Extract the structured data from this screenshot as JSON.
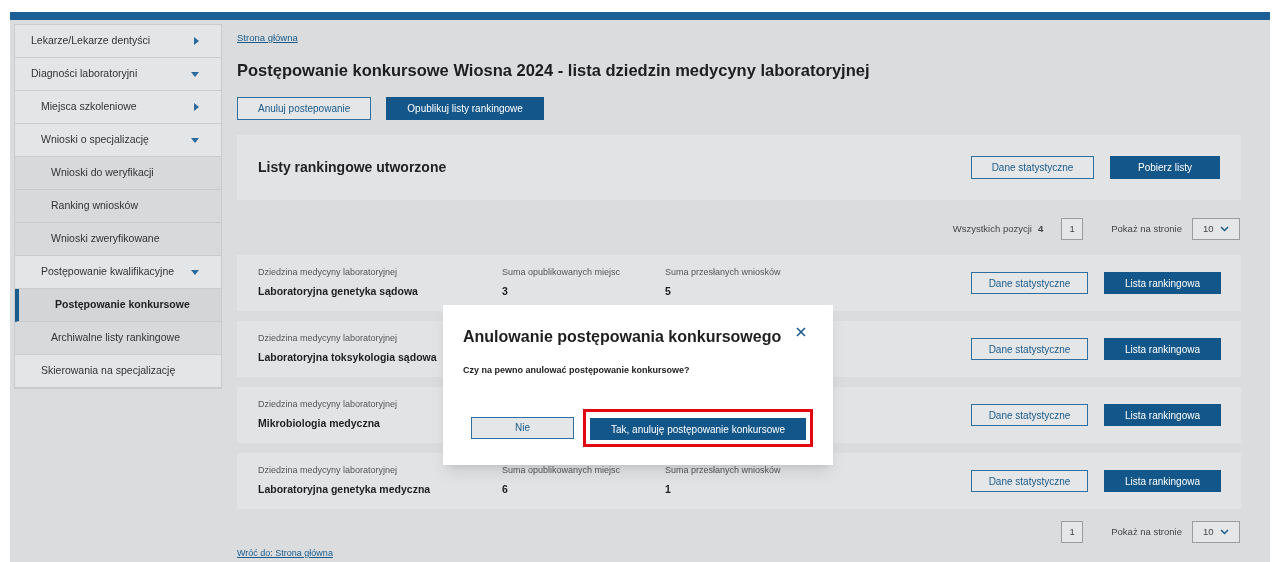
{
  "sidebar": {
    "items": [
      {
        "label": "Lekarze/Lekarze dentyści",
        "expanded": false,
        "selected": false
      },
      {
        "label": "Diagności laboratoryjni",
        "expanded": true,
        "selected": false,
        "children": [
          {
            "label": "Miejsca szkoleniowe",
            "expanded": false,
            "selected": false
          },
          {
            "label": "Wnioski o specjalizację",
            "expanded": true,
            "selected": false,
            "children": [
              {
                "label": "Wnioski do weryfikacji",
                "selected": false
              },
              {
                "label": "Ranking wniosków",
                "selected": false
              },
              {
                "label": "Wnioski zweryfikowane",
                "selected": false
              }
            ]
          },
          {
            "label": "Postępowanie kwalifikacyjne",
            "expanded": true,
            "selected": false,
            "children": [
              {
                "label": "Postępowanie konkursowe",
                "selected": true
              },
              {
                "label": "Archiwalne listy rankingowe",
                "selected": false
              }
            ]
          },
          {
            "label": "Skierowania na specjalizację",
            "selected": false
          }
        ]
      }
    ]
  },
  "breadcrumb": "Strona główna",
  "title": "Postępowanie konkursowe Wiosna 2024 - lista dziedzin medycyny laboratoryjnej",
  "actions": [
    {
      "label": "Anuluj postepowanie",
      "kind": "secondary"
    },
    {
      "label": "Opublikuj listy rankingowe",
      "kind": "primary"
    }
  ],
  "summary_card": {
    "title": "Listy rankingowe utworzone",
    "buttons": [
      {
        "label": "Dane statystyczne",
        "kind": "secondary"
      },
      {
        "label": "Pobierz listy",
        "kind": "primary"
      }
    ]
  },
  "pagination_top": {
    "total_label": "Wszystkich pozycji",
    "total": "4",
    "page": "1",
    "per_page_label": "Pokaż na stronie",
    "per_page": "10"
  },
  "rows": [
    {
      "fields": [
        {
          "label": "Dziedzina medycyny laboratoryjnej",
          "value": "Laboratoryjna genetyka sądowa"
        },
        {
          "label": "Suma opublikowanych miejsc",
          "value": "3"
        },
        {
          "label": "Suma przesłanych wniosków",
          "value": "5"
        }
      ],
      "buttons": [
        {
          "label": "Dane statystyczne",
          "kind": "secondary"
        },
        {
          "label": "Lista rankingowa",
          "kind": "primary"
        }
      ]
    },
    {
      "fields": [
        {
          "label": "Dziedzina medycyny laboratoryjnej",
          "value": "Laboratoryjna toksykologia sądowa"
        }
      ],
      "buttons": [
        {
          "label": "Dane statystyczne",
          "kind": "secondary"
        },
        {
          "label": "Lista rankingowa",
          "kind": "primary"
        }
      ]
    },
    {
      "fields": [
        {
          "label": "Dziedzina medycyny laboratoryjnej",
          "value": "Mikrobiologia medyczna"
        }
      ],
      "buttons": [
        {
          "label": "Dane statystyczne",
          "kind": "secondary"
        },
        {
          "label": "Lista rankingowa",
          "kind": "primary"
        }
      ]
    },
    {
      "fields": [
        {
          "label": "Dziedzina medycyny laboratoryjnej",
          "value": "Laboratoryjna genetyka medyczna"
        },
        {
          "label": "Suma opublikowanych miejsc",
          "value": "6"
        },
        {
          "label": "Suma przesłanych wniosków",
          "value": "1"
        }
      ],
      "buttons": [
        {
          "label": "Dane statystyczne",
          "kind": "secondary"
        },
        {
          "label": "Lista rankingowa",
          "kind": "primary"
        }
      ]
    }
  ],
  "pagination_bottom": {
    "page": "1",
    "per_page_label": "Pokaż na stronie",
    "per_page": "10"
  },
  "back_link": "Wróć do: Strona główna",
  "dialog": {
    "title": "Anulowanie postępowania konkursowego",
    "message": "Czy na pewno anulować postępowanie konkursowe?",
    "buttons": [
      {
        "label": "Nie",
        "kind": "secondary",
        "highlighted": false
      },
      {
        "label": "Tak, anuluję postępowanie konkursowe",
        "kind": "primary",
        "highlighted": true
      }
    ]
  }
}
